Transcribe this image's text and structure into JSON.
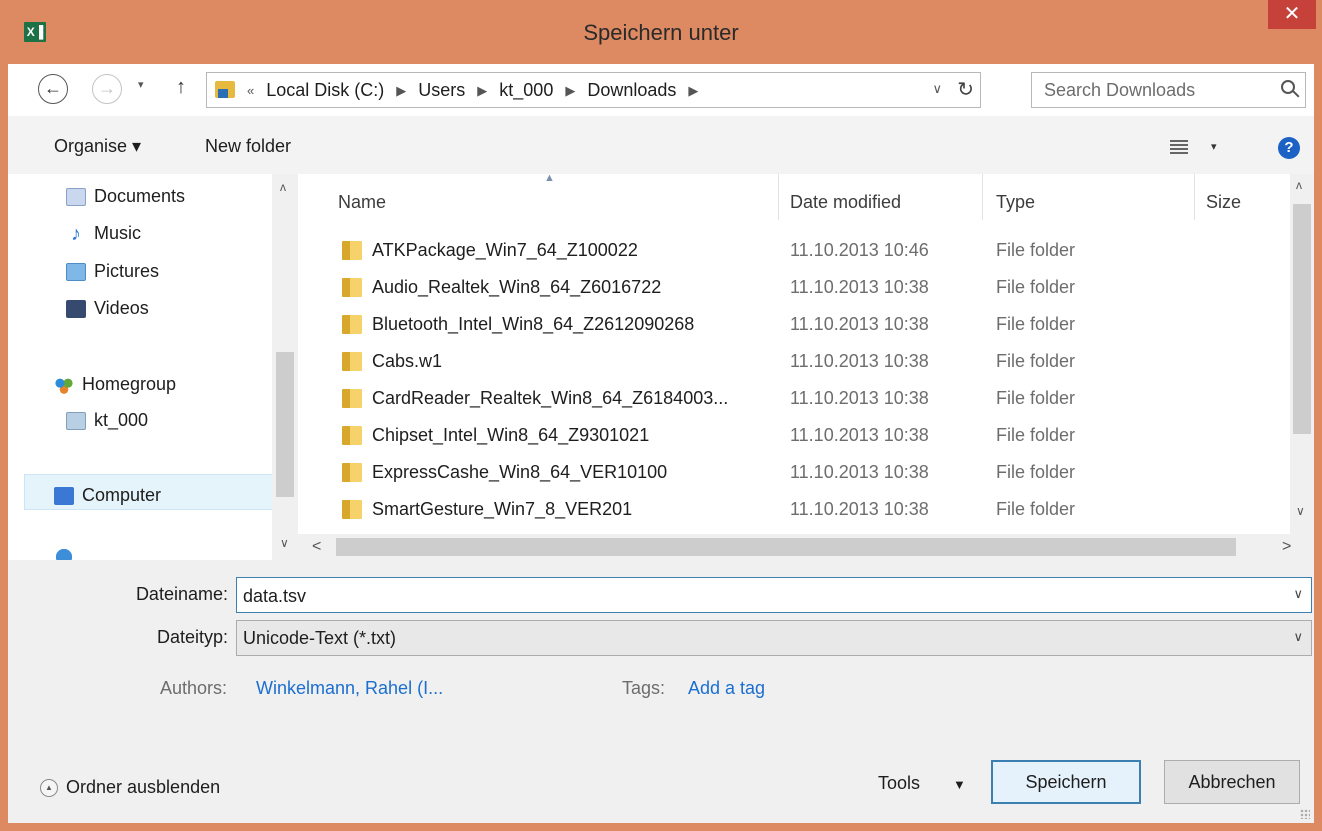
{
  "window": {
    "title": "Speichern unter",
    "app_icon": "X▐",
    "close_glyph": "✕"
  },
  "nav": {
    "back_glyph": "←",
    "forward_glyph": "→",
    "recent_glyph": "▾",
    "up_glyph": "↑",
    "address": {
      "prefix": "«",
      "crumbs": [
        "Local Disk (C:)",
        "Users",
        "kt_000",
        "Downloads"
      ],
      "sep": "▶",
      "dropdown_glyph": "∨",
      "refresh_glyph": "↻"
    },
    "search_placeholder": "Search Downloads"
  },
  "toolbar": {
    "organise_label": "Organise ▾",
    "new_folder_label": "New folder",
    "view_dd_glyph": "▾",
    "help_glyph": "?"
  },
  "navpane": {
    "items": [
      {
        "label": "Documents",
        "icon": "documents-icon"
      },
      {
        "label": "Music",
        "icon": "music-icon"
      },
      {
        "label": "Pictures",
        "icon": "pictures-icon"
      },
      {
        "label": "Videos",
        "icon": "videos-icon"
      },
      {
        "label": "Homegroup",
        "icon": "homegroup-icon"
      },
      {
        "label": "kt_000",
        "icon": "user-icon"
      },
      {
        "label": "Computer",
        "icon": "computer-icon"
      }
    ],
    "scroll_up": "ʌ",
    "scroll_down": "∨"
  },
  "filelist": {
    "columns": {
      "name": "Name",
      "date": "Date modified",
      "type": "Type",
      "size": "Size"
    },
    "sort_glyph": "▲",
    "rows": [
      {
        "name": "ATKPackage_Win7_64_Z100022",
        "date": "11.10.2013 10:46",
        "type": "File folder"
      },
      {
        "name": "Audio_Realtek_Win8_64_Z6016722",
        "date": "11.10.2013 10:38",
        "type": "File folder"
      },
      {
        "name": "Bluetooth_Intel_Win8_64_Z2612090268",
        "date": "11.10.2013 10:38",
        "type": "File folder"
      },
      {
        "name": "Cabs.w1",
        "date": "11.10.2013 10:38",
        "type": "File folder"
      },
      {
        "name": "CardReader_Realtek_Win8_64_Z6184003...",
        "date": "11.10.2013 10:38",
        "type": "File folder"
      },
      {
        "name": "Chipset_Intel_Win8_64_Z9301021",
        "date": "11.10.2013 10:38",
        "type": "File folder"
      },
      {
        "name": "ExpressCashe_Win8_64_VER10100",
        "date": "11.10.2013 10:38",
        "type": "File folder"
      },
      {
        "name": "SmartGesture_Win7_8_VER201",
        "date": "11.10.2013 10:38",
        "type": "File folder"
      }
    ],
    "scroll_up": "ʌ",
    "scroll_down": "∨",
    "scroll_left": "<",
    "scroll_right": ">"
  },
  "form": {
    "filename_label": "Dateiname:",
    "filename_value": "data.tsv",
    "filetype_label": "Dateityp:",
    "filetype_value": "Unicode-Text (*.txt)",
    "dropdown_glyph": "∨",
    "authors_label": "Authors:",
    "authors_value": "Winkelmann, Rahel (I...",
    "tags_label": "Tags:",
    "tags_value": "Add a tag"
  },
  "footer": {
    "hide_label": "Ordner ausblenden",
    "hide_glyph": "▲",
    "tools_label": "Tools",
    "tools_dd": "▼",
    "save_label": "Speichern",
    "cancel_label": "Abbrechen"
  },
  "colors": {
    "title_bar": "#dd8a63",
    "close": "#c7413b",
    "link": "#1a6fcf",
    "selected": "#e5f3fb"
  }
}
